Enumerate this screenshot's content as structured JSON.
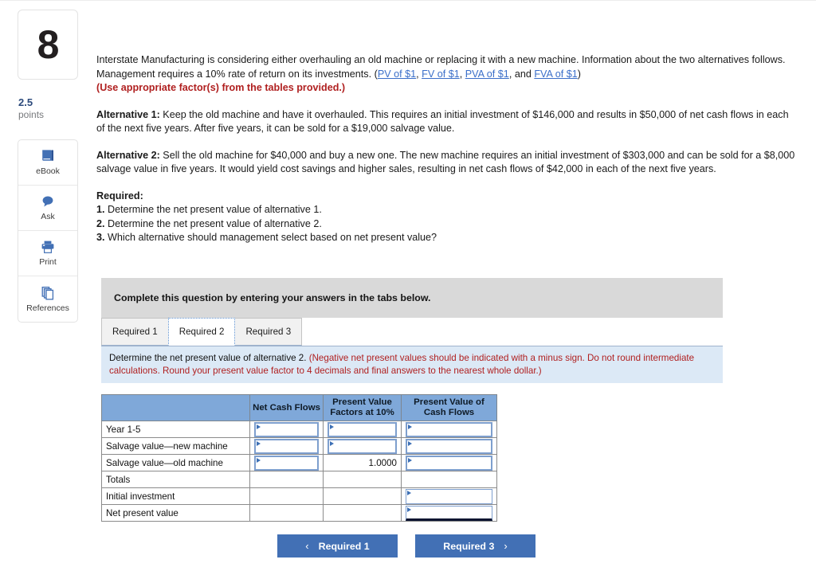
{
  "question": {
    "number": "8",
    "points_value": "2.5",
    "points_label": "points"
  },
  "tools": [
    {
      "label": "eBook",
      "icon": "book-icon"
    },
    {
      "label": "Ask",
      "icon": "speech-bubble-icon"
    },
    {
      "label": "Print",
      "icon": "printer-icon"
    },
    {
      "label": "References",
      "icon": "documents-icon"
    }
  ],
  "prompt": {
    "intro_a": "Interstate Manufacturing is considering either overhauling an old machine or replacing it with a new machine. Information about the two alternatives follows. Management requires a 10% rate of return on its investments. (",
    "link_pv": "PV of $1",
    "sep1": ", ",
    "link_fv": "FV of $1",
    "sep2": ", ",
    "link_pva": "PVA of $1",
    "sep3": ", and ",
    "link_fva": "FVA of $1",
    "intro_b": ")",
    "use_factors": "(Use appropriate factor(s) from the tables provided.)",
    "alt1_label": "Alternative 1:",
    "alt1_text": " Keep the old machine and have it overhauled. This requires an initial investment of $146,000 and results in $50,000 of net cash flows in each of the next five years. After five years, it can be sold for a $19,000 salvage value.",
    "alt2_label": "Alternative 2:",
    "alt2_text": " Sell the old machine for $40,000 and buy a new one. The new machine requires an initial investment of $303,000 and can be sold for a $8,000 salvage value in five years. It would yield cost savings and higher sales, resulting in net cash flows of $42,000 in each of the next five years.",
    "required_head": "Required:",
    "req_items": [
      {
        "num": "1.",
        "text": " Determine the net present value of alternative 1."
      },
      {
        "num": "2.",
        "text": " Determine the net present value of alternative 2."
      },
      {
        "num": "3.",
        "text": " Which alternative should management select based on net present value?"
      }
    ]
  },
  "panel": {
    "complete_banner": "Complete this question by entering your answers in the tabs below.",
    "tabs": [
      {
        "label": "Required 1",
        "active": false
      },
      {
        "label": "Required 2",
        "active": true
      },
      {
        "label": "Required 3",
        "active": false
      }
    ],
    "info_main": "Determine the net present value of alternative 2. ",
    "info_note": "(Negative net present values should be indicated with a minus sign. Do not round intermediate calculations. Round your present value factor to 4 decimals and final answers to the nearest whole dollar.)"
  },
  "table": {
    "headers": [
      "",
      "Net Cash Flows",
      "Present Value Factors at 10%",
      "Present Value of Cash Flows"
    ],
    "rows": [
      {
        "label": "Year 1-5",
        "c1": "",
        "c2": "",
        "c3": ""
      },
      {
        "label": "Salvage value—new machine",
        "c1": "",
        "c2": "",
        "c3": ""
      },
      {
        "label": "Salvage value—old machine",
        "c1": "",
        "c2": "1.0000",
        "c3": ""
      },
      {
        "label": "Totals",
        "c1": "",
        "c2": "",
        "c3": ""
      },
      {
        "label": "Initial investment",
        "c1": "",
        "c2": "",
        "c3": ""
      },
      {
        "label": "Net present value",
        "c1": "",
        "c2": "",
        "c3": ""
      }
    ]
  },
  "nav": {
    "prev_label": "Required 1",
    "prev_chevron": "‹",
    "next_label": "Required 3",
    "next_chevron": "›"
  },
  "colors": {
    "accent_blue": "#4270b5",
    "header_blue": "#7fa8d9",
    "info_blue": "#dce9f6",
    "banner_gray": "#d9d9d9",
    "link_blue": "#3b6fc9",
    "red": "#b02020"
  }
}
